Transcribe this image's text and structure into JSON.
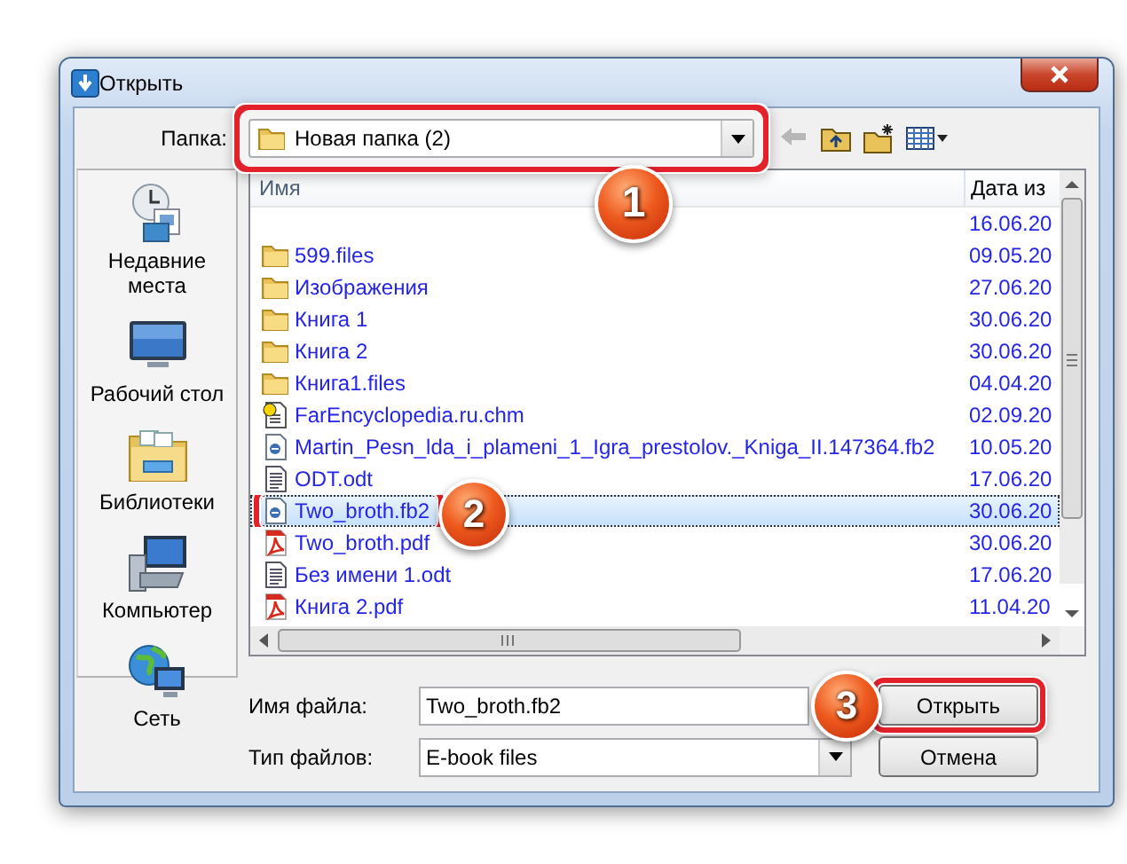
{
  "window": {
    "title": "Открыть"
  },
  "folder": {
    "label": "Папка:",
    "value": "Новая папка (2)",
    "callout": "1"
  },
  "nav_buttons": [
    {
      "kind": "back",
      "disabled": true
    },
    {
      "kind": "up",
      "disabled": false
    },
    {
      "kind": "new-folder",
      "disabled": false
    },
    {
      "kind": "view",
      "disabled": false
    }
  ],
  "places": [
    {
      "kind": "recent",
      "label": "Недавние места"
    },
    {
      "kind": "desktop",
      "label": "Рабочий стол"
    },
    {
      "kind": "libraries",
      "label": "Библиотеки"
    },
    {
      "kind": "computer",
      "label": "Компьютер"
    },
    {
      "kind": "network",
      "label": "Сеть"
    }
  ],
  "file_list": {
    "columns": [
      "Имя",
      "Дата из"
    ],
    "rows": [
      {
        "date": "16.06.20",
        "selected": false
      },
      {
        "kind": "folder",
        "name": "599.files",
        "date": "09.05.20",
        "selected": false
      },
      {
        "kind": "folder",
        "name": "Изображения",
        "date": "27.06.20",
        "selected": false
      },
      {
        "kind": "folder",
        "name": "Книга 1",
        "date": "30.06.20",
        "selected": false
      },
      {
        "kind": "folder",
        "name": "Книга 2",
        "date": "30.06.20",
        "selected": false
      },
      {
        "kind": "folder",
        "name": "Книга1.files",
        "date": "04.04.20",
        "selected": false
      },
      {
        "kind": "help",
        "name": "FarEncyclopedia.ru.chm",
        "date": "02.09.20",
        "selected": false
      },
      {
        "kind": "ebook",
        "name": "Martin_Pesn_lda_i_plameni_1_Igra_prestolov._Kniga_II.147364.fb2",
        "date": "10.05.20",
        "selected": false
      },
      {
        "kind": "document",
        "name": "ODT.odt",
        "date": "17.06.20",
        "selected": false
      },
      {
        "kind": "ebook",
        "name": "Two_broth.fb2",
        "date": "30.06.20",
        "selected": true,
        "callout": "2"
      },
      {
        "kind": "pdf",
        "name": "Two_broth.pdf",
        "date": "30.06.20",
        "selected": false
      },
      {
        "kind": "document",
        "name": "Без имени 1.odt",
        "date": "17.06.20",
        "selected": false
      },
      {
        "kind": "pdf",
        "name": "Книга 2.pdf",
        "date": "11.04.20",
        "selected": false
      }
    ]
  },
  "file_name": {
    "label": "Имя файла:",
    "value": "Two_broth.fb2"
  },
  "file_type": {
    "label": "Тип файлов:",
    "value": "E-book files"
  },
  "buttons": [
    {
      "label": "Открыть",
      "callout": "3"
    },
    {
      "label": "Отмена"
    }
  ]
}
